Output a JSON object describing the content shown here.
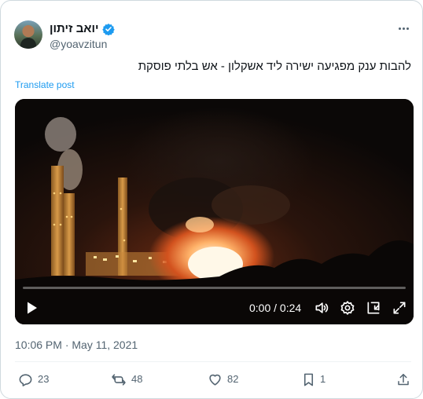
{
  "author": {
    "display_name": "יואב זיתון",
    "handle": "@yoavzitun"
  },
  "tweet": {
    "text": "להבות ענק מפגיעה ישירה ליד אשקלון - אש בלתי פוסקת",
    "translate_label": "Translate post",
    "timestamp": "10:06 PM · May 11, 2021"
  },
  "video": {
    "time_label": "0:00 / 0:24",
    "progress": 0
  },
  "actions": {
    "replies": "23",
    "reposts": "48",
    "likes": "82",
    "bookmarks": "1"
  },
  "colors": {
    "accent": "#1d9bf0",
    "text_secondary": "#536471",
    "border": "#cfd9de"
  },
  "icons": {
    "verified": "verified-badge-icon",
    "more": "more-icon",
    "play": "play-icon",
    "volume": "volume-icon",
    "settings": "settings-icon",
    "docked": "docked-player-icon",
    "fullscreen": "fullscreen-icon",
    "reply": "reply-icon",
    "repost": "repost-icon",
    "like": "heart-icon",
    "bookmark": "bookmark-icon",
    "share": "share-icon"
  }
}
